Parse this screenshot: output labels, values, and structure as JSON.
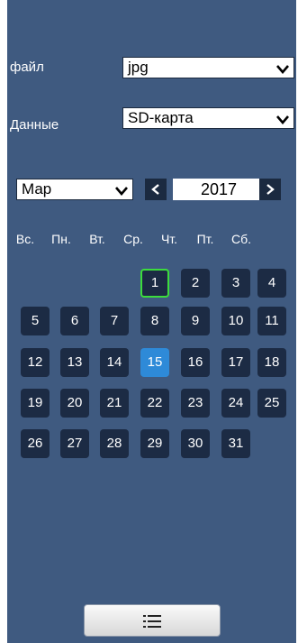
{
  "file_row": {
    "label": "файл",
    "value": "jpg"
  },
  "data_row": {
    "label": "Данные",
    "value": "SD-карта"
  },
  "calendar": {
    "month": "Мар",
    "year": "2017",
    "weekdays": [
      "Вс.",
      "Пн.",
      "Вт.",
      "Ср.",
      "Чт.",
      "Пт.",
      "Сб."
    ],
    "days": [
      "1",
      "2",
      "3",
      "4",
      "5",
      "6",
      "7",
      "8",
      "9",
      "10",
      "11",
      "12",
      "13",
      "14",
      "15",
      "16",
      "17",
      "18",
      "19",
      "20",
      "21",
      "22",
      "23",
      "24",
      "25",
      "26",
      "27",
      "28",
      "29",
      "30",
      "31"
    ],
    "today": "1",
    "selected": "15"
  },
  "colors": {
    "panel": "#3f5a80",
    "day_cell": "#1c2b44",
    "selected_day": "#2e8ad8",
    "today_border": "#3cdc3c"
  },
  "icons": {
    "dropdown": "chevron-down-icon",
    "prev": "chevron-left-icon",
    "next": "chevron-right-icon",
    "list_button": "list-icon"
  }
}
